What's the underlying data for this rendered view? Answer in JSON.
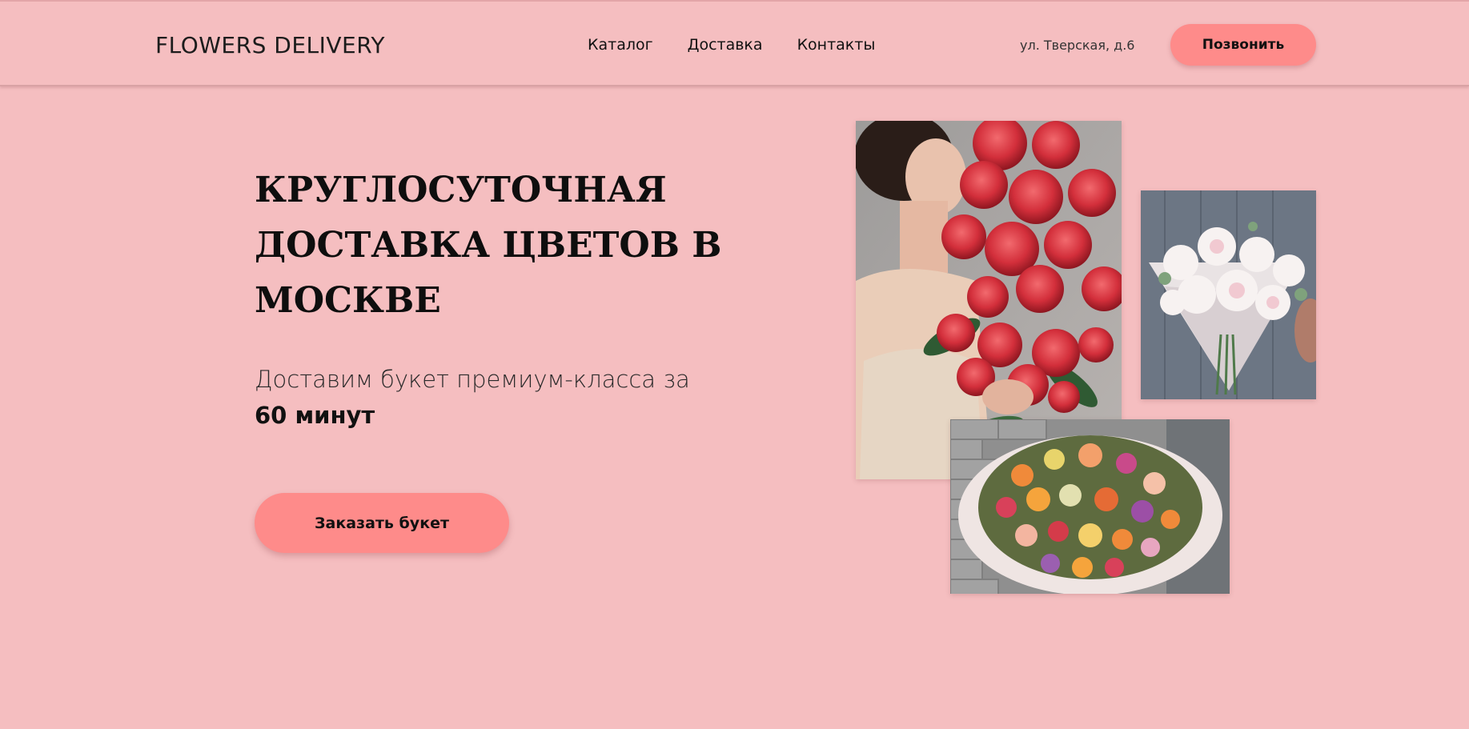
{
  "header": {
    "logo": "FLOWERS DELIVERY",
    "nav": [
      "Каталог",
      "Доставка",
      "Контакты"
    ],
    "address": "ул. Тверская, д.6",
    "call_label": "Позвонить"
  },
  "hero": {
    "title_lines": [
      "КРУГЛОСУТОЧНАЯ",
      "ДОСТАВКА ЦВЕТОВ В",
      "МОСКВЕ"
    ],
    "subtitle": "Доставим букет премиум-класса за",
    "subtitle_strong": "60 минут",
    "order_label": "Заказать букет"
  },
  "colors": {
    "background": "#f5bec0",
    "accent_button": "#fe8b8a",
    "text": "#111111"
  },
  "images": [
    {
      "name": "woman-with-red-roses-photo"
    },
    {
      "name": "white-peony-bouquet-photo"
    },
    {
      "name": "mixed-colorful-bouquet-photo"
    }
  ]
}
